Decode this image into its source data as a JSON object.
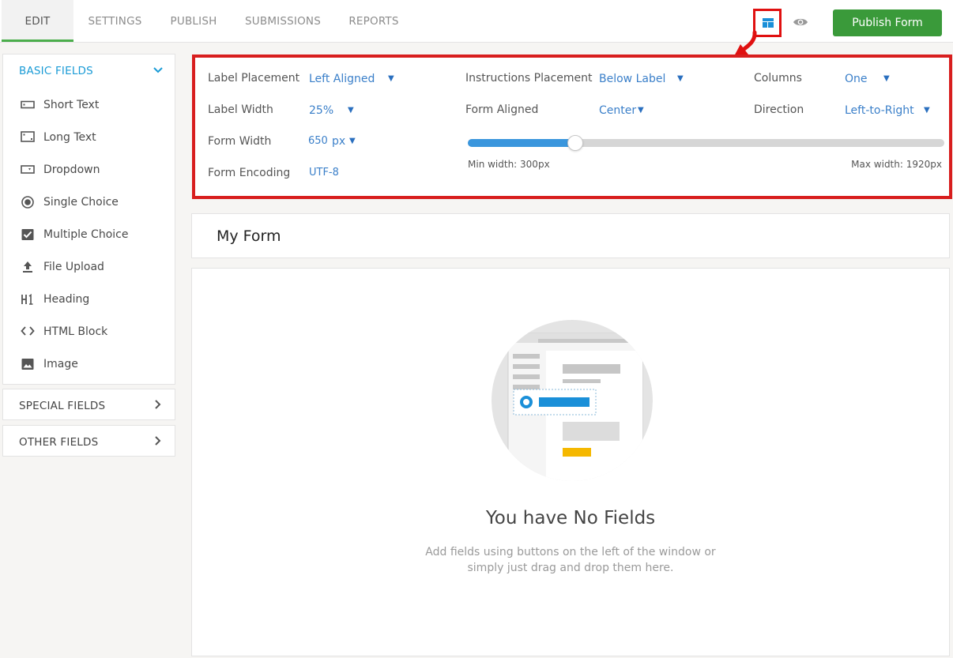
{
  "tabs": [
    {
      "label": "EDIT",
      "active": true
    },
    {
      "label": "SETTINGS"
    },
    {
      "label": "PUBLISH"
    },
    {
      "label": "SUBMISSIONS"
    },
    {
      "label": "REPORTS"
    }
  ],
  "header": {
    "publish_label": "Publish Form",
    "icons": [
      "layout-icon",
      "eye-icon"
    ]
  },
  "colors": {
    "accent_green": "#3a9a3a",
    "link_blue": "#3a7fc9",
    "highlight_red": "#d81e1e",
    "section_teal": "#1a9bd6"
  },
  "sidebar": {
    "basic_fields_label": "BASIC FIELDS",
    "items": [
      {
        "label": "Short Text",
        "icon": "short-text-icon"
      },
      {
        "label": "Long Text",
        "icon": "long-text-icon"
      },
      {
        "label": "Dropdown",
        "icon": "dropdown-icon"
      },
      {
        "label": "Single Choice",
        "icon": "radio-icon"
      },
      {
        "label": "Multiple Choice",
        "icon": "checkbox-icon"
      },
      {
        "label": "File Upload",
        "icon": "upload-icon"
      },
      {
        "label": "Heading",
        "icon": "heading-icon"
      },
      {
        "label": "HTML Block",
        "icon": "code-icon"
      },
      {
        "label": "Image",
        "icon": "image-icon"
      }
    ],
    "special_fields_label": "SPECIAL FIELDS",
    "other_fields_label": "OTHER FIELDS"
  },
  "settings": {
    "label_placement": {
      "label": "Label Placement",
      "value": "Left Aligned"
    },
    "instructions_placement": {
      "label": "Instructions Placement",
      "value": "Below Label"
    },
    "columns": {
      "label": "Columns",
      "value": "One"
    },
    "label_width": {
      "label": "Label Width",
      "value": "25%"
    },
    "form_aligned": {
      "label": "Form Aligned",
      "value": "Center"
    },
    "direction": {
      "label": "Direction",
      "value": "Left-to-Right"
    },
    "form_width": {
      "label": "Form Width",
      "value": "650",
      "unit": "px",
      "min": 300,
      "max": 1920
    },
    "form_encoding": {
      "label": "Form Encoding",
      "value": "UTF-8"
    },
    "min_width_text": "Min width: 300px",
    "max_width_text": "Max width: 1920px"
  },
  "form": {
    "title": "My Form",
    "empty_title": "You have No Fields",
    "empty_line1": "Add fields using buttons on the left of the window or",
    "empty_line2": "simply just drag and drop them here."
  }
}
